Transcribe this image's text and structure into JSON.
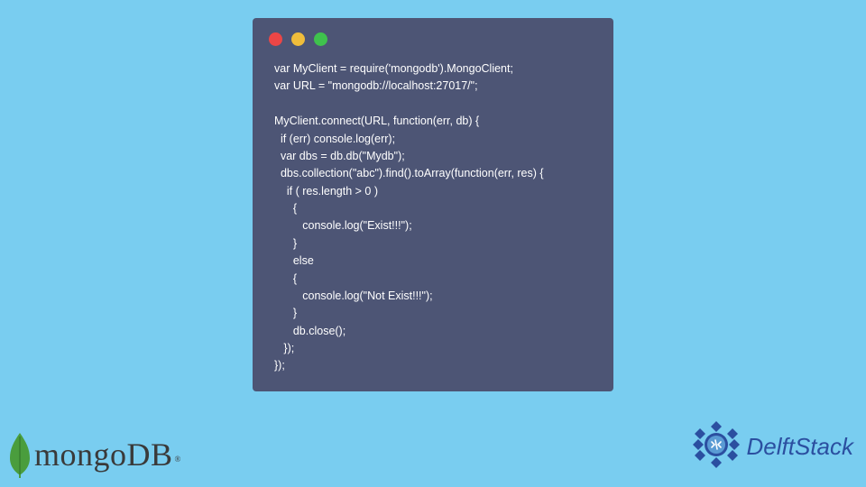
{
  "code": {
    "lines": [
      "var MyClient = require('mongodb').MongoClient;",
      "var URL = \"mongodb://localhost:27017/\";",
      "",
      "MyClient.connect(URL, function(err, db) {",
      "  if (err) console.log(err);",
      "  var dbs = db.db(\"Mydb\");",
      "  dbs.collection(\"abc\").find().toArray(function(err, res) {",
      "    if ( res.length > 0 )",
      "      {",
      "         console.log(\"Exist!!!\");",
      "      }",
      "      else",
      "      {",
      "         console.log(\"Not Exist!!!\");",
      "      }",
      "      db.close();",
      "   });",
      "});"
    ]
  },
  "logos": {
    "mongo": "mongoDB",
    "mongo_tm": "®",
    "delft": "DelftStack"
  },
  "colors": {
    "bg": "#79cdf0",
    "window": "#4d5575",
    "red": "#ec4646",
    "yellow": "#f0bd3b",
    "green": "#3fc24d",
    "leaf": "#4a9d3d",
    "delft_blue": "#2b4fa0"
  }
}
